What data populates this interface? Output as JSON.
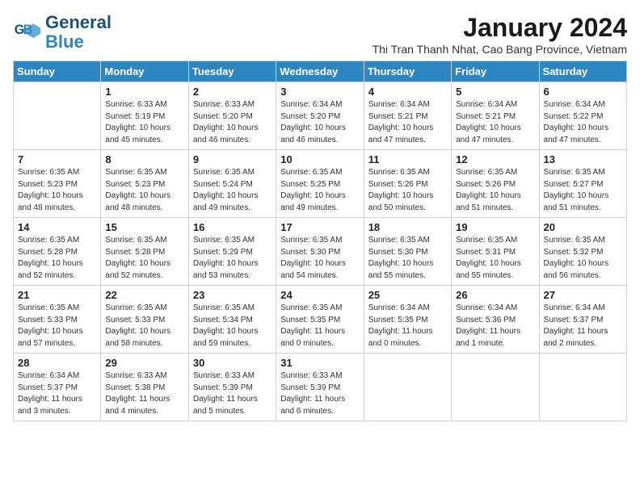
{
  "logo": {
    "line1": "General",
    "line2": "Blue"
  },
  "title": "January 2024",
  "subtitle": "Thi Tran Thanh Nhat, Cao Bang Province, Vietnam",
  "days_of_week": [
    "Sunday",
    "Monday",
    "Tuesday",
    "Wednesday",
    "Thursday",
    "Friday",
    "Saturday"
  ],
  "weeks": [
    [
      {
        "day": "",
        "info": ""
      },
      {
        "day": "1",
        "info": "Sunrise: 6:33 AM\nSunset: 5:19 PM\nDaylight: 10 hours\nand 45 minutes."
      },
      {
        "day": "2",
        "info": "Sunrise: 6:33 AM\nSunset: 5:20 PM\nDaylight: 10 hours\nand 46 minutes."
      },
      {
        "day": "3",
        "info": "Sunrise: 6:34 AM\nSunset: 5:20 PM\nDaylight: 10 hours\nand 46 minutes."
      },
      {
        "day": "4",
        "info": "Sunrise: 6:34 AM\nSunset: 5:21 PM\nDaylight: 10 hours\nand 47 minutes."
      },
      {
        "day": "5",
        "info": "Sunrise: 6:34 AM\nSunset: 5:21 PM\nDaylight: 10 hours\nand 47 minutes."
      },
      {
        "day": "6",
        "info": "Sunrise: 6:34 AM\nSunset: 5:22 PM\nDaylight: 10 hours\nand 47 minutes."
      }
    ],
    [
      {
        "day": "7",
        "info": "Sunrise: 6:35 AM\nSunset: 5:23 PM\nDaylight: 10 hours\nand 48 minutes."
      },
      {
        "day": "8",
        "info": "Sunrise: 6:35 AM\nSunset: 5:23 PM\nDaylight: 10 hours\nand 48 minutes."
      },
      {
        "day": "9",
        "info": "Sunrise: 6:35 AM\nSunset: 5:24 PM\nDaylight: 10 hours\nand 49 minutes."
      },
      {
        "day": "10",
        "info": "Sunrise: 6:35 AM\nSunset: 5:25 PM\nDaylight: 10 hours\nand 49 minutes."
      },
      {
        "day": "11",
        "info": "Sunrise: 6:35 AM\nSunset: 5:26 PM\nDaylight: 10 hours\nand 50 minutes."
      },
      {
        "day": "12",
        "info": "Sunrise: 6:35 AM\nSunset: 5:26 PM\nDaylight: 10 hours\nand 51 minutes."
      },
      {
        "day": "13",
        "info": "Sunrise: 6:35 AM\nSunset: 5:27 PM\nDaylight: 10 hours\nand 51 minutes."
      }
    ],
    [
      {
        "day": "14",
        "info": "Sunrise: 6:35 AM\nSunset: 5:28 PM\nDaylight: 10 hours\nand 52 minutes."
      },
      {
        "day": "15",
        "info": "Sunrise: 6:35 AM\nSunset: 5:28 PM\nDaylight: 10 hours\nand 52 minutes."
      },
      {
        "day": "16",
        "info": "Sunrise: 6:35 AM\nSunset: 5:29 PM\nDaylight: 10 hours\nand 53 minutes."
      },
      {
        "day": "17",
        "info": "Sunrise: 6:35 AM\nSunset: 5:30 PM\nDaylight: 10 hours\nand 54 minutes."
      },
      {
        "day": "18",
        "info": "Sunrise: 6:35 AM\nSunset: 5:30 PM\nDaylight: 10 hours\nand 55 minutes."
      },
      {
        "day": "19",
        "info": "Sunrise: 6:35 AM\nSunset: 5:31 PM\nDaylight: 10 hours\nand 55 minutes."
      },
      {
        "day": "20",
        "info": "Sunrise: 6:35 AM\nSunset: 5:32 PM\nDaylight: 10 hours\nand 56 minutes."
      }
    ],
    [
      {
        "day": "21",
        "info": "Sunrise: 6:35 AM\nSunset: 5:33 PM\nDaylight: 10 hours\nand 57 minutes."
      },
      {
        "day": "22",
        "info": "Sunrise: 6:35 AM\nSunset: 5:33 PM\nDaylight: 10 hours\nand 58 minutes."
      },
      {
        "day": "23",
        "info": "Sunrise: 6:35 AM\nSunset: 5:34 PM\nDaylight: 10 hours\nand 59 minutes."
      },
      {
        "day": "24",
        "info": "Sunrise: 6:35 AM\nSunset: 5:35 PM\nDaylight: 11 hours\nand 0 minutes."
      },
      {
        "day": "25",
        "info": "Sunrise: 6:34 AM\nSunset: 5:35 PM\nDaylight: 11 hours\nand 0 minutes."
      },
      {
        "day": "26",
        "info": "Sunrise: 6:34 AM\nSunset: 5:36 PM\nDaylight: 11 hours\nand 1 minute."
      },
      {
        "day": "27",
        "info": "Sunrise: 6:34 AM\nSunset: 5:37 PM\nDaylight: 11 hours\nand 2 minutes."
      }
    ],
    [
      {
        "day": "28",
        "info": "Sunrise: 6:34 AM\nSunset: 5:37 PM\nDaylight: 11 hours\nand 3 minutes."
      },
      {
        "day": "29",
        "info": "Sunrise: 6:33 AM\nSunset: 5:38 PM\nDaylight: 11 hours\nand 4 minutes."
      },
      {
        "day": "30",
        "info": "Sunrise: 6:33 AM\nSunset: 5:39 PM\nDaylight: 11 hours\nand 5 minutes."
      },
      {
        "day": "31",
        "info": "Sunrise: 6:33 AM\nSunset: 5:39 PM\nDaylight: 11 hours\nand 6 minutes."
      },
      {
        "day": "",
        "info": ""
      },
      {
        "day": "",
        "info": ""
      },
      {
        "day": "",
        "info": ""
      }
    ]
  ]
}
